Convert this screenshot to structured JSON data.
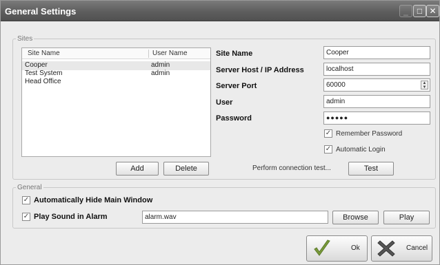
{
  "window": {
    "title": "General Settings"
  },
  "title_buttons": {
    "minimize": "_",
    "maximize": "□",
    "close": "✕"
  },
  "sites": {
    "legend": "Sites",
    "columns": [
      "Site Name",
      "User Name"
    ],
    "rows": [
      {
        "site": "Cooper",
        "user": "admin"
      },
      {
        "site": "Test System",
        "user": "admin"
      },
      {
        "site": "Head Office",
        "user": ""
      }
    ],
    "add_label": "Add",
    "delete_label": "Delete"
  },
  "form": {
    "site_name_label": "Site Name",
    "site_name_value": "Cooper",
    "host_label": "Server Host / IP Address",
    "host_value": "localhost",
    "port_label": "Server Port",
    "port_value": "60000",
    "user_label": "User",
    "user_value": "admin",
    "password_label": "Password",
    "password_value": "●●●●●",
    "remember_label": "Remember Password",
    "autologin_label": "Automatic Login",
    "conn_test_text": "Perform connection test...",
    "test_label": "Test"
  },
  "general": {
    "legend": "General",
    "auto_hide_label": "Automatically Hide Main Window",
    "play_sound_label": "Play Sound in Alarm",
    "sound_file": "alarm.wav",
    "browse_label": "Browse",
    "play_label": "Play"
  },
  "footer": {
    "ok_label": "Ok",
    "cancel_label": "Cancel"
  },
  "colors": {
    "title_bg": "#5e5e5e",
    "ok_check": "#7a9a3a",
    "cancel_x": "#555555"
  }
}
